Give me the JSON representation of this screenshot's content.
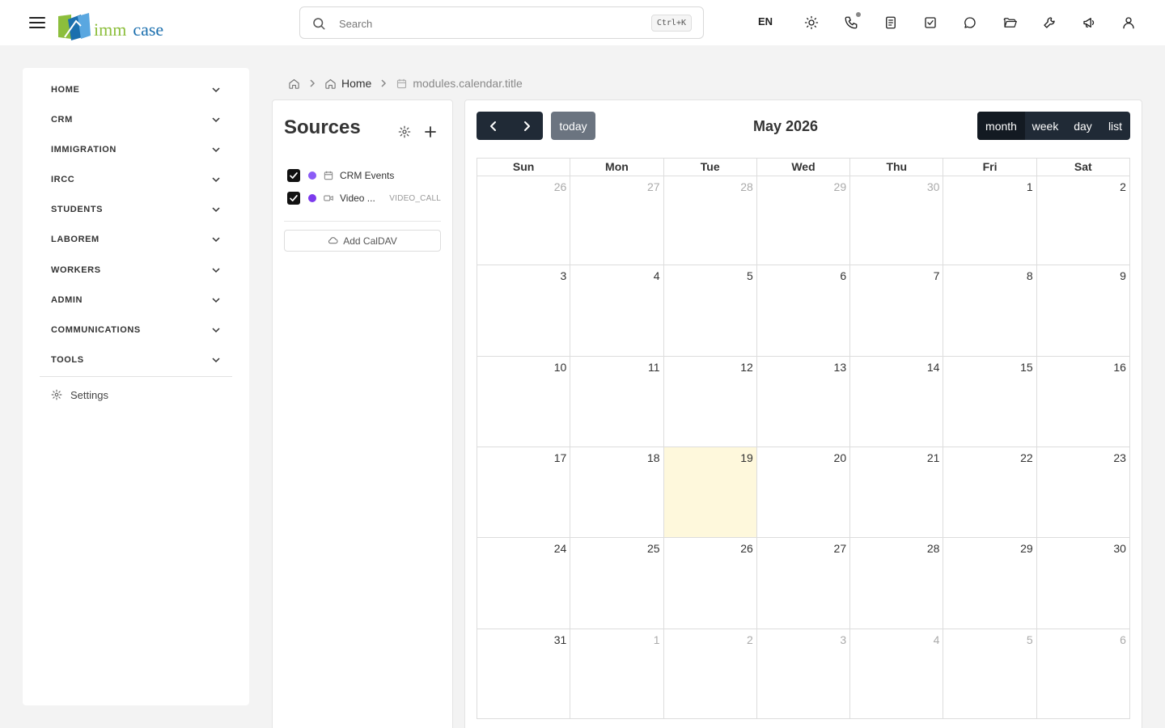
{
  "header": {
    "logo_imm": "imm",
    "logo_case": "case",
    "search_placeholder": "Search",
    "search_value": "",
    "search_shortcut": "Ctrl+K",
    "language": "EN",
    "icons": [
      "sun-icon",
      "phone-icon",
      "document-icon",
      "checkbox-icon",
      "chat-icon",
      "folder-icon",
      "wrench-icon",
      "megaphone-icon",
      "user-icon"
    ]
  },
  "sidebar": {
    "items": [
      {
        "label": "HOME"
      },
      {
        "label": "CRM"
      },
      {
        "label": "IMMIGRATION"
      },
      {
        "label": "IRCC"
      },
      {
        "label": "STUDENTS"
      },
      {
        "label": "LABOREM"
      },
      {
        "label": "WORKERS"
      },
      {
        "label": "ADMIN"
      },
      {
        "label": "COMMUNICATIONS"
      },
      {
        "label": "TOOLS"
      }
    ],
    "settings_label": "Settings"
  },
  "breadcrumb": {
    "home_label": "Home",
    "current_label": "modules.calendar.title"
  },
  "sources": {
    "title": "Sources",
    "items": [
      {
        "name": "CRM Events",
        "tag": "",
        "checked": true,
        "color": "#8b5cf6",
        "icon": "calendar-icon"
      },
      {
        "name": "Video ...",
        "tag": "VIDEO_CALL",
        "checked": true,
        "color": "#7c3aed",
        "icon": "video-icon"
      }
    ],
    "add_caldav_label": "Add CalDAV"
  },
  "calendar": {
    "title": "May 2026",
    "today_label": "today",
    "views": [
      {
        "label": "month",
        "active": true
      },
      {
        "label": "week",
        "active": false
      },
      {
        "label": "day",
        "active": false
      },
      {
        "label": "list",
        "active": false
      }
    ],
    "weekdays": [
      "Sun",
      "Mon",
      "Tue",
      "Wed",
      "Thu",
      "Fri",
      "Sat"
    ],
    "today_date": 19,
    "weeks": [
      [
        {
          "d": 26,
          "o": true
        },
        {
          "d": 27,
          "o": true
        },
        {
          "d": 28,
          "o": true
        },
        {
          "d": 29,
          "o": true
        },
        {
          "d": 30,
          "o": true
        },
        {
          "d": 1
        },
        {
          "d": 2
        }
      ],
      [
        {
          "d": 3
        },
        {
          "d": 4
        },
        {
          "d": 5
        },
        {
          "d": 6
        },
        {
          "d": 7
        },
        {
          "d": 8
        },
        {
          "d": 9
        }
      ],
      [
        {
          "d": 10
        },
        {
          "d": 11
        },
        {
          "d": 12
        },
        {
          "d": 13
        },
        {
          "d": 14
        },
        {
          "d": 15
        },
        {
          "d": 16
        }
      ],
      [
        {
          "d": 17
        },
        {
          "d": 18
        },
        {
          "d": 19,
          "t": true
        },
        {
          "d": 20
        },
        {
          "d": 21
        },
        {
          "d": 22
        },
        {
          "d": 23
        }
      ],
      [
        {
          "d": 24
        },
        {
          "d": 25
        },
        {
          "d": 26
        },
        {
          "d": 27
        },
        {
          "d": 28
        },
        {
          "d": 29
        },
        {
          "d": 30
        }
      ],
      [
        {
          "d": 31
        },
        {
          "d": 1,
          "o": true
        },
        {
          "d": 2,
          "o": true
        },
        {
          "d": 3,
          "o": true
        },
        {
          "d": 4,
          "o": true
        },
        {
          "d": 5,
          "o": true
        },
        {
          "d": 6,
          "o": true
        }
      ]
    ]
  }
}
